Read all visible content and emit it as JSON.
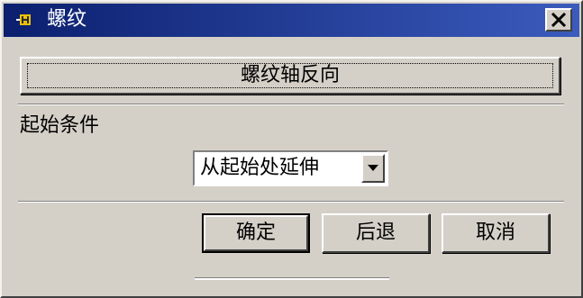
{
  "window": {
    "title": "螺纹",
    "close_label": "×"
  },
  "buttons": {
    "reverse_axis": "螺纹轴反向",
    "ok": "确定",
    "back": "后退",
    "cancel": "取消"
  },
  "start_condition": {
    "label": "起始条件",
    "selected": "从起始处延伸"
  },
  "colors": {
    "titlebar_start": "#0b1f6e",
    "titlebar_end": "#3b5bbd",
    "dialog_bg": "#d4d0c8",
    "icon_accent": "#e8c000"
  }
}
